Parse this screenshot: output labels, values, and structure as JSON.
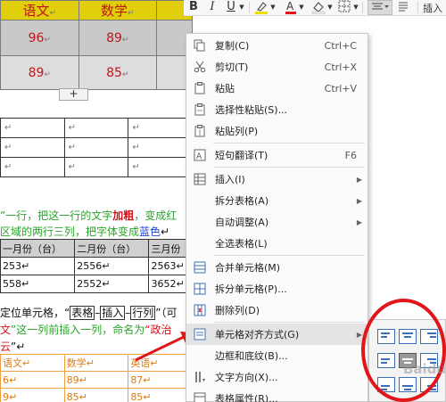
{
  "document": {
    "score_table": {
      "headers": [
        "语文",
        "数学"
      ],
      "rows": [
        [
          "96",
          "89"
        ],
        [
          "89",
          "85"
        ]
      ],
      "para_mark": "↵"
    },
    "add_row_button": "+",
    "plain_table_mark": "↵",
    "paragraph1": {
      "line1_a": "”一行，把这一行的文字",
      "line1_bold": "加粗",
      "line1_b": "，变成红",
      "line2_a": "区域的两行三列，把字体变成",
      "line2_blue": "蓝色",
      "line2_end": "↵"
    },
    "month_table": {
      "headers": [
        "一月份（台）",
        "二月份（台）",
        "三月份"
      ],
      "rows": [
        [
          "253↵",
          "2556↵",
          "2563↵"
        ],
        [
          "558↵",
          "2552↵",
          "3652↵"
        ]
      ]
    },
    "paragraph2": {
      "line1_a": "定位单元格，“",
      "box1": "表格",
      "dash1": "–",
      "box2": "插入",
      "dash2": "–",
      "box3": "行列",
      "line1_b": "”（可",
      "line2_red_a": "文",
      "line2_a": "”这一列前插入一列，命名为",
      "line2_red_b": "“政治",
      "line3_red": "云",
      "line3_b": "”↵"
    },
    "bottom_table": {
      "headers": [
        "语文↵",
        "数学↵",
        "英语↵"
      ],
      "rows": [
        [
          "6↵",
          "89↵",
          "87↵"
        ],
        [
          "9↵",
          "85↵",
          "85↵"
        ]
      ]
    }
  },
  "ribbon": {
    "bold": "B",
    "italic": "I",
    "underline": "U",
    "insert_label": "插入"
  },
  "context_menu": {
    "items": [
      {
        "label": "复制(C)",
        "shortcut": "Ctrl+C",
        "icon": "copy-icon"
      },
      {
        "label": "剪切(T)",
        "shortcut": "Ctrl+X",
        "icon": "scissors-icon"
      },
      {
        "label": "粘贴",
        "shortcut": "Ctrl+V",
        "icon": "paste-icon"
      },
      {
        "label": "选择性粘贴(S)...",
        "shortcut": "",
        "icon": "paste-special-icon"
      },
      {
        "label": "粘贴列(P)",
        "shortcut": "",
        "icon": "paste-column-icon"
      },
      {
        "label": "短句翻译(T)",
        "shortcut": "F6",
        "icon": "translate-icon"
      },
      {
        "label": "插入(I)",
        "shortcut": "",
        "icon": "insert-table-icon",
        "submenu": true
      },
      {
        "label": "拆分表格(A)",
        "shortcut": "",
        "icon": "",
        "submenu": true
      },
      {
        "label": "自动调整(A)",
        "shortcut": "",
        "icon": "",
        "submenu": true
      },
      {
        "label": "全选表格(L)",
        "shortcut": "",
        "icon": ""
      },
      {
        "label": "合并单元格(M)",
        "shortcut": "",
        "icon": "merge-cells-icon"
      },
      {
        "label": "拆分单元格(P)...",
        "shortcut": "",
        "icon": "split-cells-icon"
      },
      {
        "label": "删除列(D)",
        "shortcut": "",
        "icon": "delete-column-icon"
      },
      {
        "label": "单元格对齐方式(G)",
        "shortcut": "",
        "icon": "cell-align-icon",
        "submenu": true
      },
      {
        "label": "边框和底纹(B)...",
        "shortcut": "",
        "icon": ""
      },
      {
        "label": "文字方向(X)...",
        "shortcut": "",
        "icon": "text-direction-icon"
      },
      {
        "label": "表格属性(R)...",
        "shortcut": "",
        "icon": "table-properties-icon"
      }
    ],
    "submenu_arrow": "▶"
  },
  "alignment_submenu": {
    "selected": "middle-center",
    "options": [
      "top-left",
      "top-center",
      "top-right",
      "middle-left",
      "middle-center",
      "middle-right",
      "bottom-left",
      "bottom-center",
      "bottom-right"
    ]
  },
  "watermark": "Baidu",
  "colors": {
    "header_yellow": "#e0cf0a",
    "annotation_red": "#e0161b",
    "align_blue": "#3d6fb8"
  }
}
